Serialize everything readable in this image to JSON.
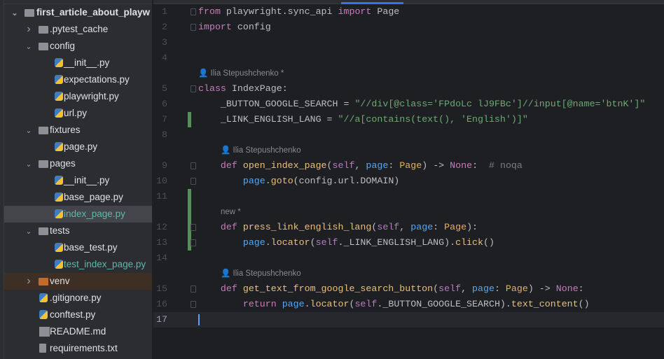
{
  "project_tree": [
    {
      "label": "first_article_about_playw",
      "level": 0,
      "type": "folder",
      "expanded": true,
      "bold": true
    },
    {
      "label": ".pytest_cache",
      "level": 1,
      "type": "folder",
      "expanded": false
    },
    {
      "label": "config",
      "level": 1,
      "type": "package",
      "expanded": true
    },
    {
      "label": "__init__.py",
      "level": 2,
      "type": "py"
    },
    {
      "label": "expectations.py",
      "level": 2,
      "type": "py"
    },
    {
      "label": "playwright.py",
      "level": 2,
      "type": "py"
    },
    {
      "label": "url.py",
      "level": 2,
      "type": "py"
    },
    {
      "label": "fixtures",
      "level": 1,
      "type": "folder",
      "expanded": true
    },
    {
      "label": "page.py",
      "level": 2,
      "type": "py"
    },
    {
      "label": "pages",
      "level": 1,
      "type": "package",
      "expanded": true
    },
    {
      "label": "__init__.py",
      "level": 2,
      "type": "py"
    },
    {
      "label": "base_page.py",
      "level": 2,
      "type": "py"
    },
    {
      "label": "index_page.py",
      "level": 2,
      "type": "py",
      "selected": true,
      "modified": true
    },
    {
      "label": "tests",
      "level": 1,
      "type": "folder",
      "expanded": true
    },
    {
      "label": "base_test.py",
      "level": 2,
      "type": "py"
    },
    {
      "label": "test_index_page.py",
      "level": 2,
      "type": "py",
      "modified": true
    },
    {
      "label": "venv",
      "level": 1,
      "type": "venv",
      "expanded": false
    },
    {
      "label": ".gitignore.py",
      "level": 1,
      "type": "py",
      "file": true
    },
    {
      "label": "conftest.py",
      "level": 1,
      "type": "py",
      "file": true
    },
    {
      "label": "README.md",
      "level": 1,
      "type": "md",
      "file": true
    },
    {
      "label": "requirements.txt",
      "level": 1,
      "type": "txt",
      "file": true
    }
  ],
  "editor_rows": [
    {
      "n": "1",
      "tokens": [
        [
          "kw",
          "from"
        ],
        [
          "plain",
          " playwright.sync_api "
        ],
        [
          "kw",
          "import"
        ],
        [
          "plain",
          " Page"
        ]
      ],
      "fold": true
    },
    {
      "n": "2",
      "tokens": [
        [
          "kw",
          "import"
        ],
        [
          "plain",
          " config"
        ]
      ],
      "fold": true
    },
    {
      "n": "3",
      "tokens": []
    },
    {
      "n": "4",
      "tokens": []
    },
    {
      "ann": "👤 Ilia Stepushchenko *",
      "indent": 0
    },
    {
      "n": "5",
      "tokens": [
        [
          "kw",
          "class"
        ],
        [
          "plain",
          " IndexPage:"
        ]
      ],
      "fold": true
    },
    {
      "n": "6",
      "tokens": [
        [
          "plain",
          "    _BUTTON_GOOGLE_SEARCH = "
        ],
        [
          "str",
          "\"//div[@class='FPdoLc lJ9FBc']//input[@name='btnK']\""
        ]
      ]
    },
    {
      "n": "7",
      "tokens": [
        [
          "plain",
          "    _LINK_ENGLISH_LANG = "
        ],
        [
          "str",
          "\"//a[contains(text(), 'English')]\""
        ]
      ],
      "changed": true
    },
    {
      "n": "8",
      "tokens": []
    },
    {
      "ann": "👤 Ilia Stepushchenko",
      "indent": 4
    },
    {
      "n": "9",
      "tokens": [
        [
          "kw",
          "    def "
        ],
        [
          "fn",
          "open_index_page"
        ],
        [
          "plain",
          "("
        ],
        [
          "self",
          "self"
        ],
        [
          "plain",
          ", "
        ],
        [
          "par",
          "page"
        ],
        [
          "plain",
          ": "
        ],
        [
          "cls",
          "Page"
        ],
        [
          "plain",
          ") -> "
        ],
        [
          "kw",
          "None"
        ],
        [
          "plain",
          ":  "
        ],
        [
          "com",
          "# noqa"
        ]
      ],
      "fold": true
    },
    {
      "n": "10",
      "tokens": [
        [
          "plain",
          "        "
        ],
        [
          "par",
          "page"
        ],
        [
          "plain",
          "."
        ],
        [
          "meth",
          "goto"
        ],
        [
          "plain",
          "(config.url.DOMAIN)"
        ]
      ],
      "fold": true
    },
    {
      "n": "11",
      "tokens": [],
      "changed": true
    },
    {
      "ann": "new *",
      "indent": 4,
      "changed": true
    },
    {
      "n": "12",
      "tokens": [
        [
          "kw",
          "    def "
        ],
        [
          "fn",
          "press_link_english_lang"
        ],
        [
          "plain",
          "("
        ],
        [
          "self",
          "self"
        ],
        [
          "plain",
          ", "
        ],
        [
          "par",
          "page"
        ],
        [
          "plain",
          ": "
        ],
        [
          "cls",
          "Page"
        ],
        [
          "plain",
          "):"
        ]
      ],
      "fold": true,
      "changed": true
    },
    {
      "n": "13",
      "tokens": [
        [
          "plain",
          "        "
        ],
        [
          "par",
          "page"
        ],
        [
          "plain",
          "."
        ],
        [
          "meth",
          "locator"
        ],
        [
          "plain",
          "("
        ],
        [
          "self",
          "self"
        ],
        [
          "plain",
          "._LINK_ENGLISH_LANG)."
        ],
        [
          "meth",
          "click"
        ],
        [
          "plain",
          "()"
        ]
      ],
      "fold": true,
      "changed": true
    },
    {
      "n": "14",
      "tokens": []
    },
    {
      "ann": "👤 Ilia Stepushchenko",
      "indent": 4
    },
    {
      "n": "15",
      "tokens": [
        [
          "kw",
          "    def "
        ],
        [
          "fn",
          "get_text_from_google_search_button"
        ],
        [
          "plain",
          "("
        ],
        [
          "self",
          "self"
        ],
        [
          "plain",
          ", "
        ],
        [
          "par",
          "page"
        ],
        [
          "plain",
          ": "
        ],
        [
          "cls",
          "Page"
        ],
        [
          "plain",
          ") -> "
        ],
        [
          "kw",
          "None"
        ],
        [
          "plain",
          ":"
        ]
      ],
      "fold": true
    },
    {
      "n": "16",
      "tokens": [
        [
          "kw",
          "        return "
        ],
        [
          "par",
          "page"
        ],
        [
          "plain",
          "."
        ],
        [
          "meth",
          "locator"
        ],
        [
          "plain",
          "("
        ],
        [
          "self",
          "self"
        ],
        [
          "plain",
          "._BUTTON_GOOGLE_SEARCH)."
        ],
        [
          "meth",
          "text_content"
        ],
        [
          "plain",
          "()"
        ]
      ],
      "fold": true
    },
    {
      "n": "17",
      "tokens": [],
      "current": true
    }
  ]
}
